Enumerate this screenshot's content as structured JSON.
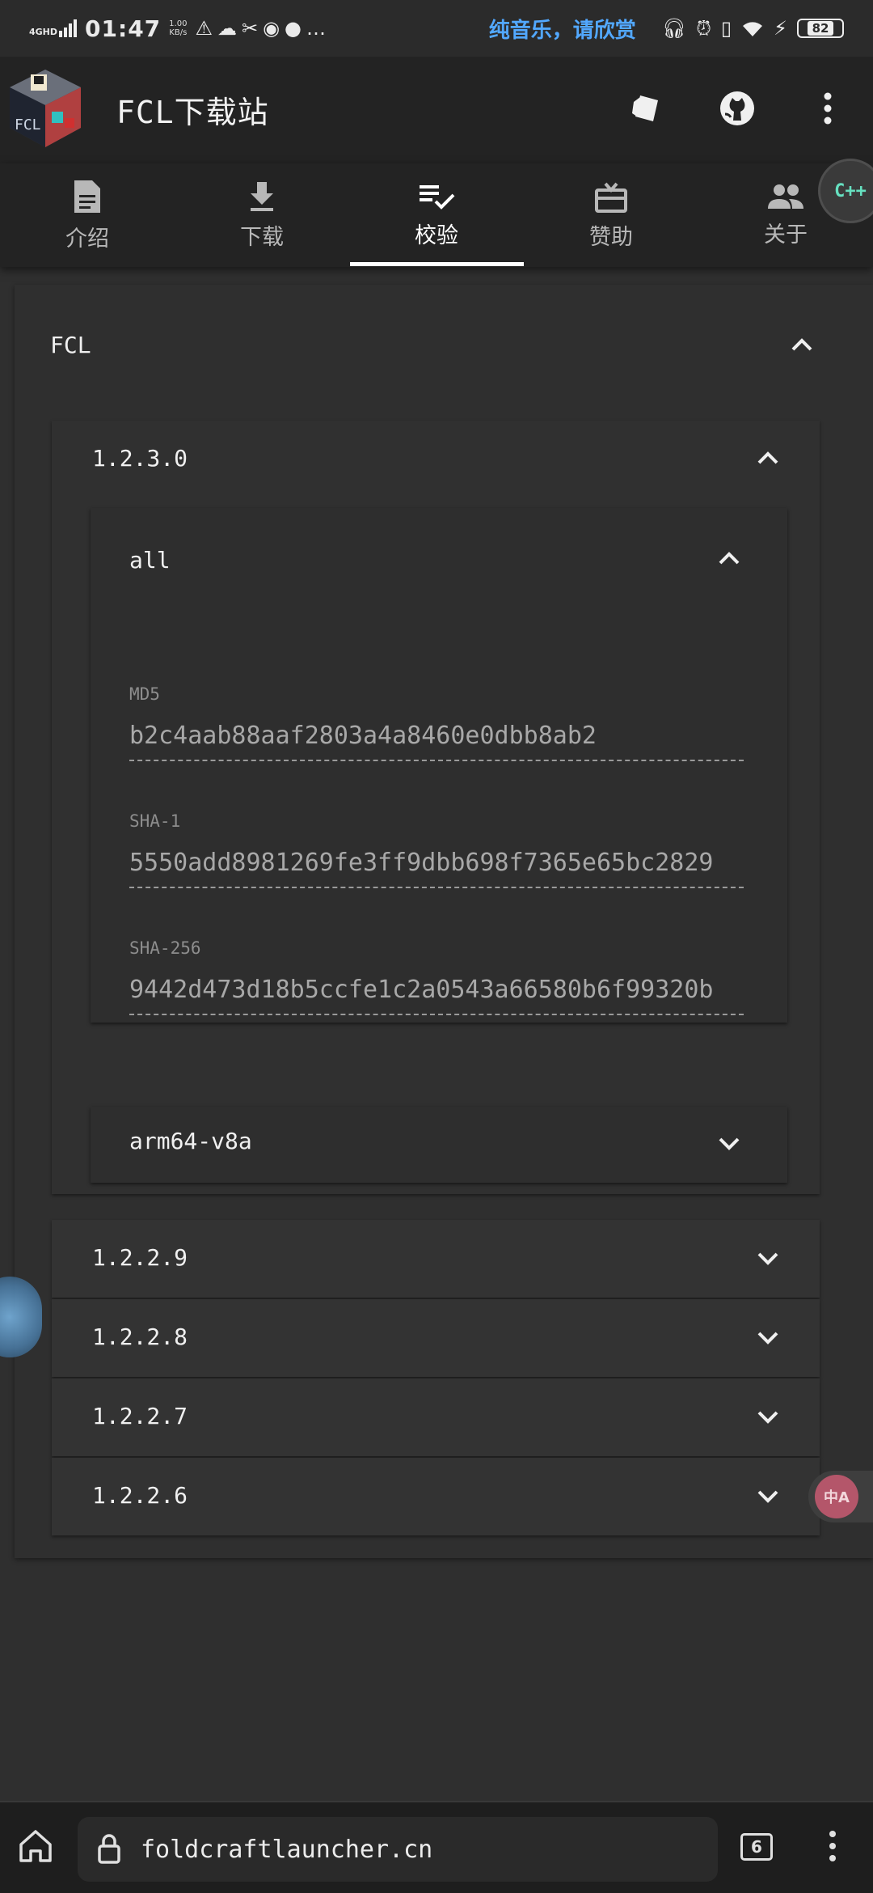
{
  "status_bar": {
    "network": "4GHD",
    "time": "01:47",
    "speed_value": "1.00",
    "speed_unit": "KB/s",
    "music_text": "纯音乐，请欣赏",
    "battery": "82"
  },
  "app_bar": {
    "title": "FCL下载站",
    "logo_text": "FCL"
  },
  "tabs": [
    {
      "label": "介绍",
      "icon": "document-icon"
    },
    {
      "label": "下载",
      "icon": "download-icon"
    },
    {
      "label": "校验",
      "icon": "checklist-icon"
    },
    {
      "label": "赞助",
      "icon": "gift-icon"
    },
    {
      "label": "关于",
      "icon": "people-icon"
    }
  ],
  "active_tab": "校验",
  "float_button_label": "C++",
  "main": {
    "section_title": "FCL",
    "expanded_version": "1.2.3.0",
    "expanded_variant": "all",
    "hashes": [
      {
        "label": "MD5",
        "value": "b2c4aab88aaf2803a4a8460e0dbb8ab2"
      },
      {
        "label": "SHA-1",
        "value": "5550add8981269fe3ff9dbb698f7365e65bc2829"
      },
      {
        "label": "SHA-256",
        "value": "9442d473d18b5ccfe1c2a0543a66580b6f99320b"
      }
    ],
    "collapsed_variant": "arm64-v8a",
    "other_versions": [
      "1.2.2.9",
      "1.2.2.8",
      "1.2.2.7",
      "1.2.2.6"
    ]
  },
  "translate_label": "中A",
  "browser": {
    "url": "foldcraftlauncher.cn",
    "tab_count": "6"
  }
}
